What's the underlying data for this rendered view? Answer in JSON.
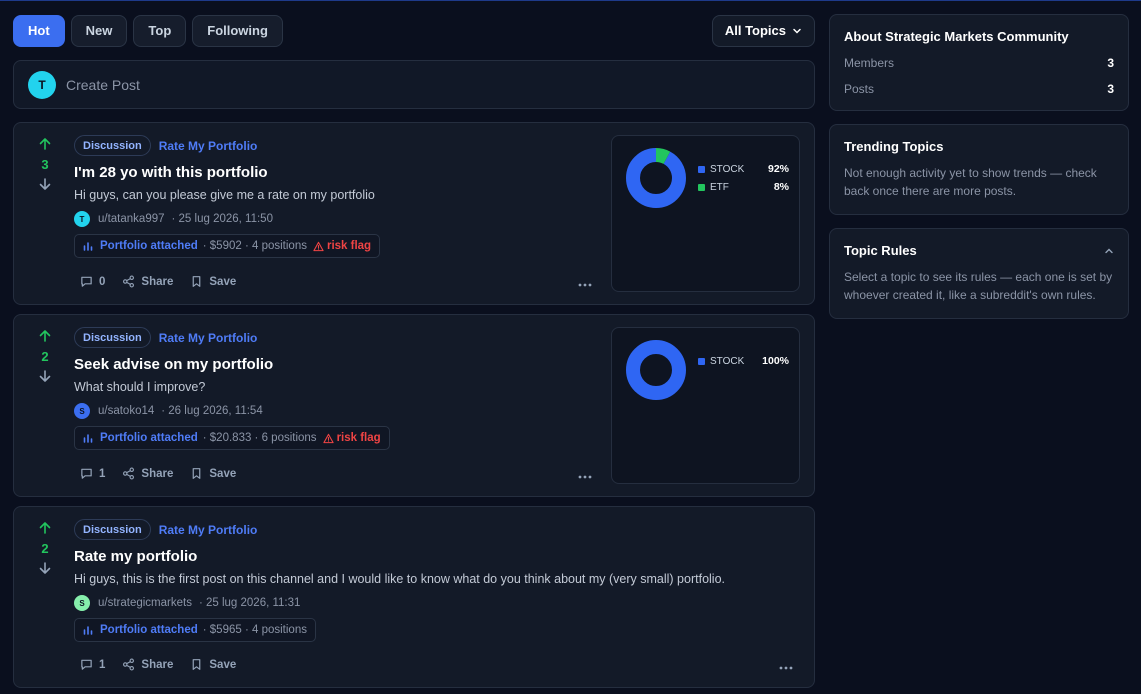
{
  "sort": {
    "tabs": [
      {
        "label": "Hot",
        "active": true
      },
      {
        "label": "New",
        "active": false
      },
      {
        "label": "Top",
        "active": false
      },
      {
        "label": "Following",
        "active": false
      }
    ],
    "topics_select": "All Topics"
  },
  "create_post": {
    "avatar_initial": "T",
    "placeholder": "Create Post"
  },
  "colors": {
    "accent": "#3b6ef0",
    "upvote": "#22c55e",
    "risk": "#ef4444",
    "stock": "#2f66f3",
    "etf": "#22c55e"
  },
  "posts": [
    {
      "votes": "3",
      "tag": "Discussion",
      "topic": "Rate My Portfolio",
      "title": "I'm 28 yo with this portfolio",
      "body": "Hi guys, can you please give me a rate on my portfolio",
      "author_initial": "T",
      "author_color": "#22d3ee",
      "author": "u/tatanka997",
      "date": "· 25 lug 2026, 11:50",
      "portfolio_label": "Portfolio attached",
      "portfolio_info": "· $5902 · 4 positions",
      "risk_label": "risk flag",
      "comments": "0",
      "share": "Share",
      "save": "Save",
      "allocation": [
        {
          "name": "STOCK",
          "pct_label": "92%",
          "value": 92,
          "color": "#2f66f3"
        },
        {
          "name": "ETF",
          "pct_label": "8%",
          "value": 8,
          "color": "#22c55e"
        }
      ]
    },
    {
      "votes": "2",
      "tag": "Discussion",
      "topic": "Rate My Portfolio",
      "title": "Seek advise on my portfolio",
      "body": "What should I improve?",
      "author_initial": "S",
      "author_color": "#3b6ef0",
      "author": "u/satoko14",
      "date": "· 26 lug 2026, 11:54",
      "portfolio_label": "Portfolio attached",
      "portfolio_info": "· $20.833 · 6 positions",
      "risk_label": "risk flag",
      "comments": "1",
      "share": "Share",
      "save": "Save",
      "allocation": [
        {
          "name": "STOCK",
          "pct_label": "100%",
          "value": 100,
          "color": "#2f66f3"
        }
      ]
    },
    {
      "votes": "2",
      "tag": "Discussion",
      "topic": "Rate My Portfolio",
      "title": "Rate my portfolio",
      "body": "Hi guys, this is the first post on this channel and I would like to know what do you think about my (very small) portfolio.",
      "author_initial": "S",
      "author_color": "#86efac",
      "author": "u/strategicmarkets",
      "date": "· 25 lug 2026, 11:31",
      "portfolio_label": "Portfolio attached",
      "portfolio_info": "· $5965 · 4 positions",
      "risk_label": "",
      "comments": "1",
      "share": "Share",
      "save": "Save",
      "allocation": []
    }
  ],
  "sidebar": {
    "about": {
      "title": "About Strategic Markets Community",
      "members_label": "Members",
      "members": "3",
      "posts_label": "Posts",
      "posts": "3"
    },
    "trending": {
      "title": "Trending Topics",
      "text": "Not enough activity yet to show trends — check back once there are more posts."
    },
    "rules": {
      "title": "Topic Rules",
      "text": "Select a topic to see its rules — each one is set by whoever created it, like a subreddit's own rules."
    }
  }
}
